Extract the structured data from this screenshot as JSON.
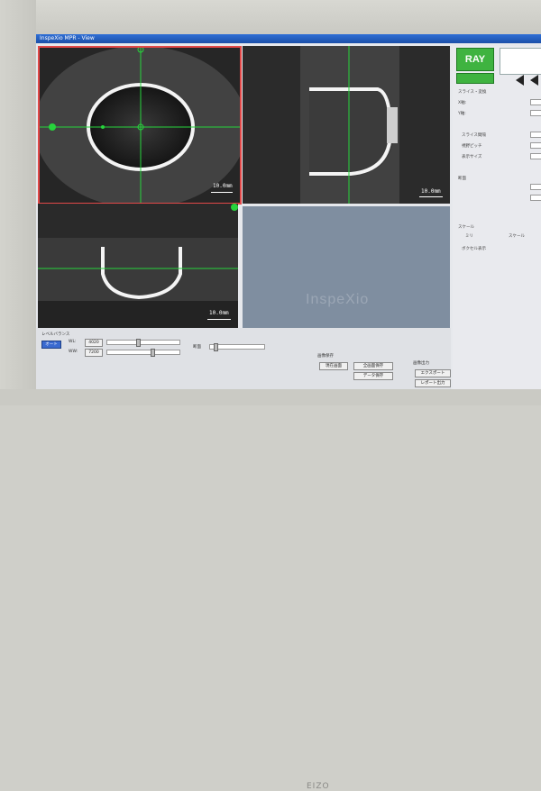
{
  "window": {
    "title": "InspeXio MPR - View"
  },
  "views": {
    "axial": {
      "scale_label": "10.0mm"
    },
    "sagittal": {
      "scale_label": "10.0mm"
    },
    "coronal": {
      "scale_label": "10.0mm"
    },
    "volume": {
      "watermark": "InspeXio"
    }
  },
  "right_panel": {
    "ray_button": "RAY",
    "labels": [
      "スライス・変換",
      "X軸:",
      "Y軸:",
      "スライス間隔",
      "視野ピッチ",
      "表示サイズ",
      "断面",
      "スケール",
      "ミリ",
      "スケール",
      "ボクセル表示"
    ]
  },
  "bottom_panel": {
    "group_label": "レベルバランス",
    "auto_button": "オート",
    "window_level_label": "WL:",
    "window_level_value": "4020",
    "window_width_label": "WW:",
    "window_width_value": "7200",
    "section_label": "断面",
    "save_group_label": "画像保存",
    "save_current": "現在画面",
    "save_all": "全画面保存",
    "save_series": "データ保存",
    "export_group_label": "画像出力",
    "export_button": "エクスポート",
    "report_button": "レポート出力"
  },
  "bezel": {
    "brand": "EIZO"
  },
  "colors": {
    "active_border": "#e24848",
    "crosshair": "#27d43c",
    "ray_green": "#3fb340"
  }
}
